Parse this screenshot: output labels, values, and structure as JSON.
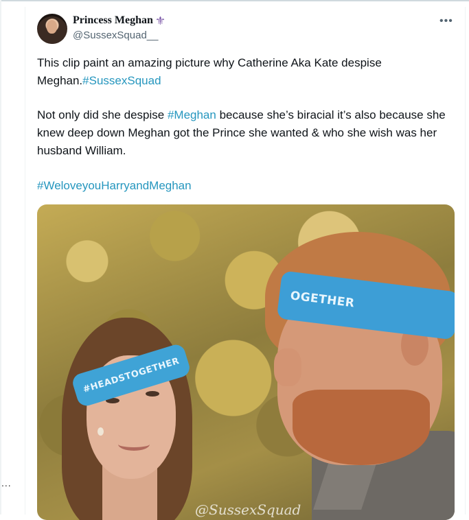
{
  "tweet": {
    "display_name": "Princess Meghan",
    "name_emoji": "⚜",
    "handle": "@SussexSquad__",
    "more_icon": "more-horizontal-icon",
    "paragraph1": {
      "text": "This clip paint an amazing picture why Catherine Aka Kate despise Meghan.",
      "hashtag": "#SussexSquad"
    },
    "paragraph2": {
      "before": "Not only did she despise ",
      "hashtag": "#Meghan",
      "after": " because she’s biracial it’s also because she knew deep down Meghan got the Prince she wanted & who she wish was her husband William."
    },
    "paragraph3": {
      "hashtag": "#WeloveyouHarryandMeghan"
    },
    "media": {
      "headband_left_text": "#HEADSTOGETHER",
      "headband_right_text": "OGETHER",
      "watermark": "@SussexSquad"
    }
  },
  "left_edge_dots": "..."
}
